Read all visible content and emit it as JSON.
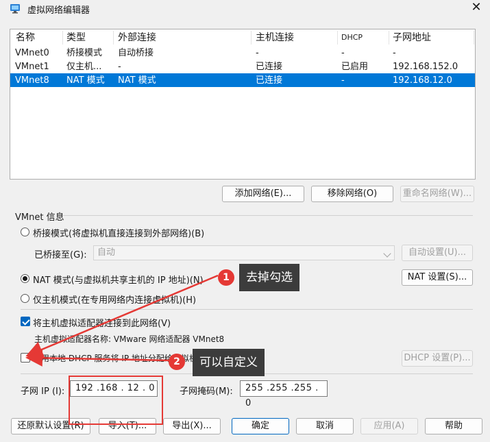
{
  "window": {
    "title": "虚拟网络编辑器",
    "close_glyph": "✕"
  },
  "list": {
    "columns": [
      "名称",
      "类型",
      "外部连接",
      "主机连接",
      "DHCP",
      "子网地址"
    ],
    "rows": [
      [
        "VMnet0",
        "桥接模式",
        "自动桥接",
        "-",
        "-",
        "-"
      ],
      [
        "VMnet1",
        "仅主机...",
        "-",
        "已连接",
        "已启用",
        "192.168.152.0"
      ],
      [
        "VMnet8",
        "NAT 模式",
        "NAT 模式",
        "已连接",
        "-",
        "192.168.12.0"
      ]
    ],
    "selected_index": 2
  },
  "list_buttons": {
    "add": "添加网络(E)...",
    "remove": "移除网络(O)",
    "rename": "重命名网络(W)..."
  },
  "vmnet_info": {
    "heading": "VMnet 信息",
    "bridged_label": "桥接模式(将虚拟机直接连接到外部网络)(B)",
    "bridged_to_label": "已桥接至(G):",
    "bridged_to_value": "自动",
    "auto_settings": "自动设置(U)...",
    "nat_label": "NAT 模式(与虚拟机共享主机的 IP 地址)(N)",
    "nat_settings": "NAT 设置(S)...",
    "host_only_label": "仅主机模式(在专用网络内连接虚拟机)(H)",
    "connect_adapter_label": "将主机虚拟适配器连接到此网络(V)",
    "adapter_name_label": "主机虚拟适配器名称: VMware 网络适配器 VMnet8",
    "dhcp_label": "使用本地 DHCP 服务将 IP 地址分配给虚拟机(D)",
    "dhcp_settings": "DHCP 设置(P)...",
    "subnet_ip_label": "子网 IP (I):",
    "subnet_ip_value": "192 .168 . 12 .  0",
    "subnet_mask_label": "子网掩码(M):",
    "subnet_mask_value": "255 .255 .255 .  0"
  },
  "footer": {
    "restore": "还原默认设置(R)",
    "import": "导入(T)...",
    "export": "导出(X)...",
    "ok": "确定",
    "cancel": "取消",
    "apply": "应用(A)",
    "help": "帮助"
  },
  "annotations": {
    "badge1": "1",
    "tip1": "去掉勾选",
    "badge2": "2",
    "tip2": "可以自定义",
    "color": "#e53935"
  },
  "colors": {
    "selection": "#0078d7",
    "window_bg": "#f0f0f0",
    "accent": "#0067c0"
  }
}
